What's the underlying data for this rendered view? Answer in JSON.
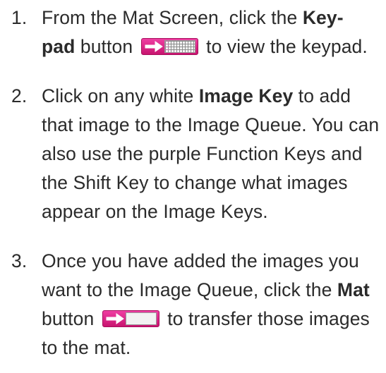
{
  "steps": [
    {
      "number": "1.",
      "text_before": "From the Mat Screen, click the ",
      "bold": "Key-pad",
      "text_middle": " button",
      "button_icon": "keypad-button-icon",
      "text_after": " to view the keypad."
    },
    {
      "number": "2.",
      "text_before": "Click on any white ",
      "bold": "Image Key",
      "text_after": " to add that image to the Image Queue. You can also use the purple Function Keys and the Shift Key to change what images appear on the Image Keys."
    },
    {
      "number": "3.",
      "text_before": "Once you have added the images you want to the Image Queue, click the ",
      "bold": "Mat",
      "text_middle": " button",
      "button_icon": "mat-button-icon",
      "text_after": " to transfer those images to the mat."
    }
  ],
  "colors": {
    "text": "#2b2b2b",
    "button_pink": "#e0268c",
    "arrow": "#ffffff"
  }
}
